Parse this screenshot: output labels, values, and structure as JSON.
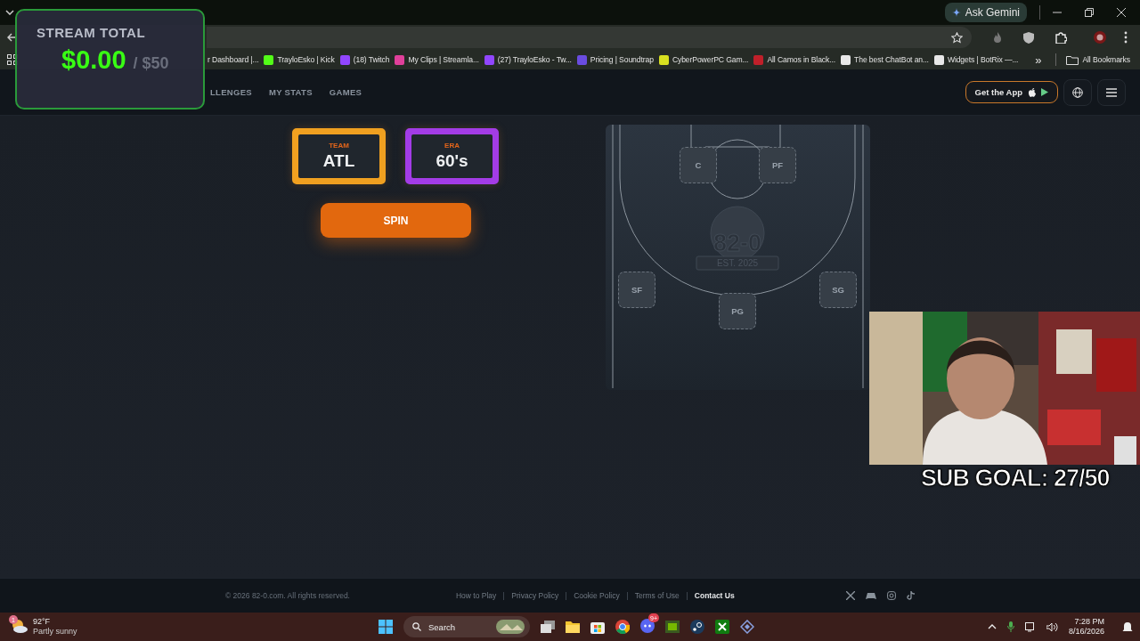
{
  "browser": {
    "ask_gemini": "Ask Gemini",
    "bookmarks": [
      {
        "label": "r Dashboard |..."
      },
      {
        "label": "TrayloEsko | Kick",
        "color": "#53fc18"
      },
      {
        "label": "(18) Twitch",
        "color": "#9146ff"
      },
      {
        "label": "My Clips | Streamla...",
        "color": "#e0409a"
      },
      {
        "label": "(27) TrayloEsko - Tw...",
        "color": "#9146ff"
      },
      {
        "label": "Pricing | Soundtrap",
        "color": "#6a4ce0"
      },
      {
        "label": "CyberPowerPC Gam...",
        "color": "#d8e020"
      },
      {
        "label": "All Camos in Black...",
        "color": "#c0202a"
      },
      {
        "label": "The best ChatBot an...",
        "color": "#e8e8e8"
      },
      {
        "label": "Widgets | BotRix —...",
        "color": "#e8e8e8"
      }
    ],
    "more": "»",
    "all_bookmarks": "All Bookmarks"
  },
  "site": {
    "nav": [
      {
        "label": "LLENGES"
      },
      {
        "label": "MY STATS"
      },
      {
        "label": "GAMES"
      }
    ],
    "get_app": "Get the App"
  },
  "main": {
    "picks": [
      {
        "label": "TEAM",
        "value": "ATL",
        "color": "#f0a020"
      },
      {
        "label": "ERA",
        "value": "60's",
        "color": "#a33ce6"
      }
    ],
    "spin": "SPIN",
    "court": {
      "logo_title": "82-0",
      "logo_subtitle": "EST. 2025",
      "positions": [
        "C",
        "PF",
        "SF",
        "SG",
        "PG"
      ]
    }
  },
  "footer": {
    "copyright": "© 2026 82-0.com. All rights reserved.",
    "links": [
      {
        "label": "How to Play",
        "selected": false
      },
      {
        "label": "Privacy Policy",
        "selected": false
      },
      {
        "label": "Cookie Policy",
        "selected": false
      },
      {
        "label": "Terms of Use",
        "selected": false
      },
      {
        "label": "Contact Us",
        "selected": true
      }
    ]
  },
  "taskbar": {
    "weather": {
      "badge": "1",
      "temperature": "92°F",
      "condition": "Partly sunny"
    },
    "search_placeholder": "Search",
    "chat_badge": "9+",
    "time": "7:28 PM",
    "date": "8/16/2026"
  },
  "overlay": {
    "title": "STREAM TOTAL",
    "amount": "$0.00",
    "goal": "/ $50",
    "sub_goal": "SUB GOAL: 27/50"
  }
}
